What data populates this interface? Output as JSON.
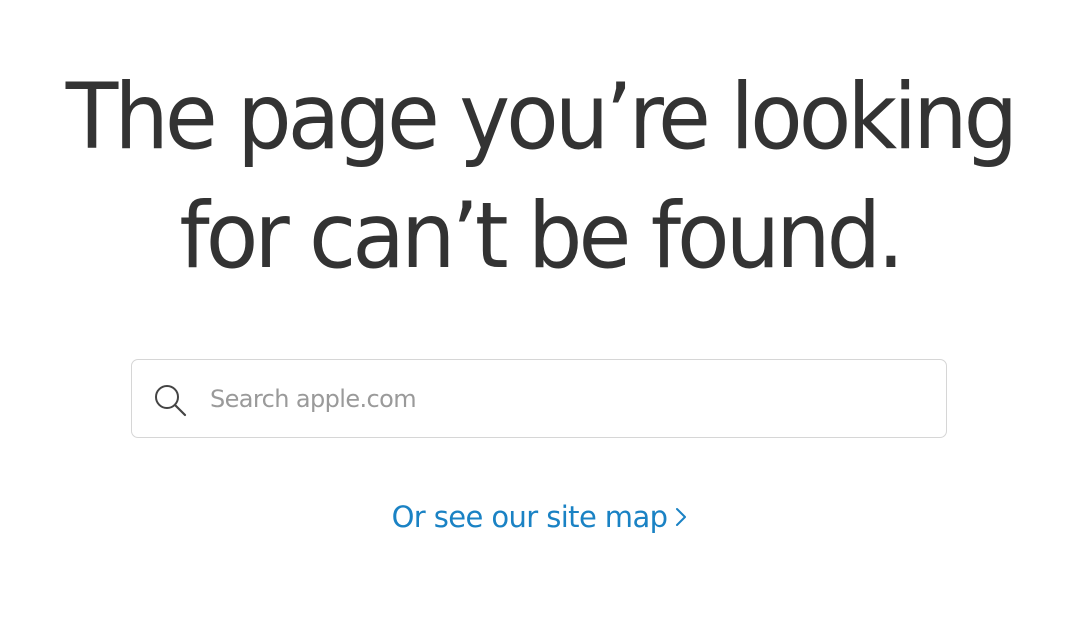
{
  "heading": {
    "line1": "The page you’re looking",
    "line2": "for can’t be found."
  },
  "search": {
    "placeholder": "Search apple.com",
    "value": "",
    "icon": "search-icon"
  },
  "sitemap_link": {
    "label": "Or see our site map",
    "icon": "chevron-right-icon"
  },
  "colors": {
    "heading": "#333333",
    "link": "#1a82c4",
    "placeholder": "#9a9a9a",
    "border": "#d6d6d6",
    "background": "#ffffff"
  }
}
